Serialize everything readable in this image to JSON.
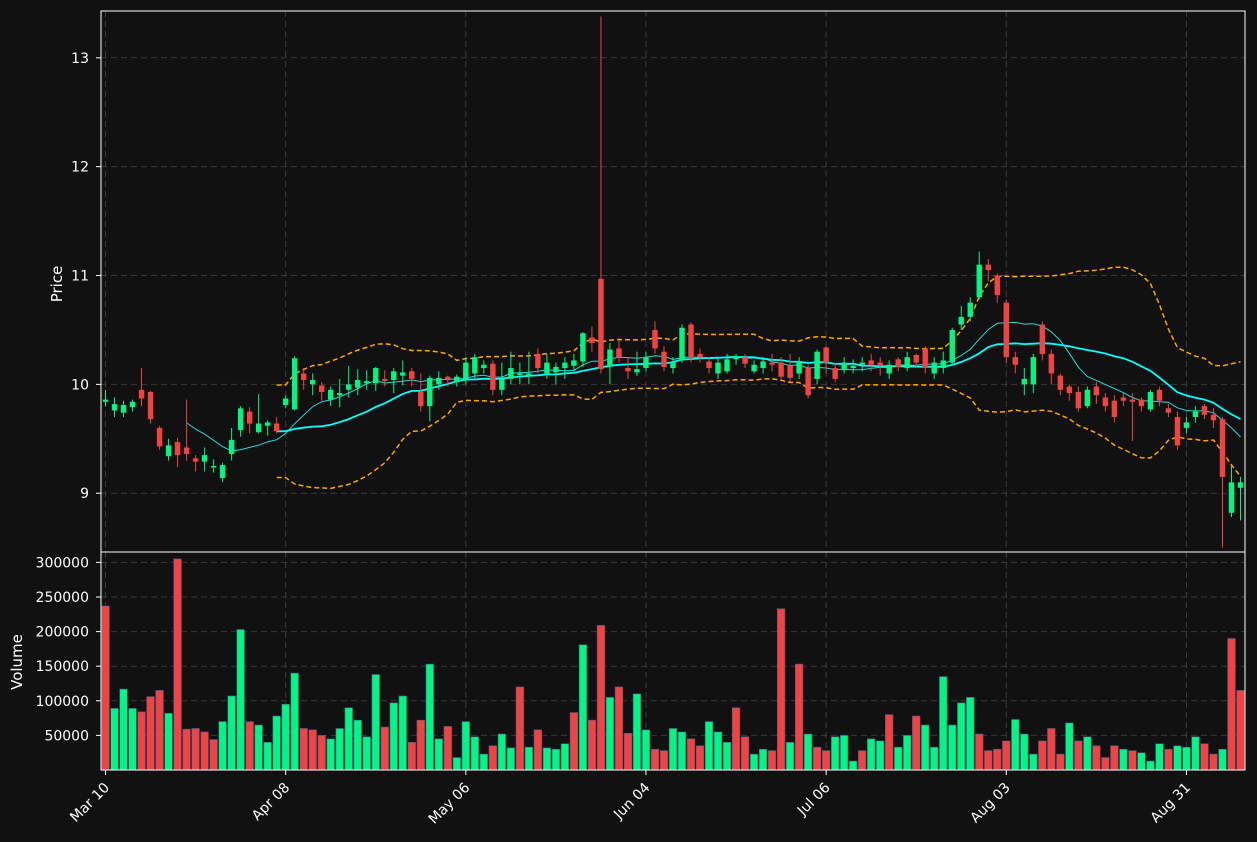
{
  "chart_data": {
    "type": "candlestick",
    "colors": {
      "background": "#111111",
      "up": "#00f583",
      "down": "#f24343",
      "grid": "#3a3a3a",
      "axis": "#ffffff",
      "ma_fast": "#26d9d9",
      "ma_slow": "#00ffff",
      "band": "#ffa500"
    },
    "price_panel": {
      "ylabel": "Price",
      "yticks": [
        9,
        10,
        11,
        12,
        13
      ],
      "ylim": [
        8.46,
        13.43
      ],
      "grid": true
    },
    "volume_panel": {
      "ylabel": "Volume",
      "yticks": [
        50000,
        100000,
        150000,
        200000,
        250000,
        300000
      ],
      "ylim": [
        0,
        315000
      ],
      "grid": true
    },
    "xaxis": {
      "tick_labels": [
        "Mar 10",
        "Apr 08",
        "May 06",
        "Jun 04",
        "Jul 06",
        "Aug 03",
        "Aug 31"
      ],
      "tick_indices": [
        0,
        20,
        40,
        60,
        80,
        100,
        120
      ],
      "n_bars": 127
    },
    "candles": [
      [
        9.84,
        9.86,
        9.95,
        9.8
      ],
      [
        9.76,
        9.82,
        9.88,
        9.7
      ],
      [
        9.74,
        9.81,
        9.85,
        9.7
      ],
      [
        9.79,
        9.84,
        9.86,
        9.75
      ],
      [
        9.95,
        9.87,
        10.15,
        9.8
      ],
      [
        9.93,
        9.68,
        9.94,
        9.64
      ],
      [
        9.6,
        9.43,
        9.62,
        9.4
      ],
      [
        9.34,
        9.44,
        9.5,
        9.3
      ],
      [
        9.47,
        9.35,
        9.51,
        9.24
      ],
      [
        9.42,
        9.36,
        9.86,
        9.3
      ],
      [
        9.32,
        9.29,
        9.35,
        9.2
      ],
      [
        9.29,
        9.35,
        9.42,
        9.2
      ],
      [
        9.25,
        9.25,
        9.31,
        9.19
      ],
      [
        9.14,
        9.26,
        9.28,
        9.1
      ],
      [
        9.36,
        9.49,
        9.6,
        9.3
      ],
      [
        9.58,
        9.78,
        9.8,
        9.52
      ],
      [
        9.75,
        9.64,
        9.79,
        9.55
      ],
      [
        9.56,
        9.64,
        9.91,
        9.55
      ],
      [
        9.62,
        9.65,
        9.67,
        9.53
      ],
      [
        9.64,
        9.57,
        9.7,
        9.55
      ],
      [
        9.81,
        9.87,
        9.9,
        9.78
      ],
      [
        9.77,
        10.24,
        10.26,
        9.76
      ],
      [
        10.1,
        10.04,
        10.15,
        9.95
      ],
      [
        10.0,
        10.04,
        10.1,
        9.9
      ],
      [
        9.99,
        9.93,
        10.02,
        9.85
      ],
      [
        9.86,
        9.95,
        9.98,
        9.8
      ],
      [
        9.9,
        9.92,
        10.05,
        9.79
      ],
      [
        9.95,
        10.0,
        10.17,
        9.88
      ],
      [
        9.97,
        10.04,
        10.14,
        9.9
      ],
      [
        10.01,
        10.03,
        10.13,
        9.95
      ],
      [
        10.01,
        10.15,
        10.16,
        9.94
      ],
      [
        10.05,
        10.03,
        10.13,
        9.98
      ],
      [
        10.04,
        10.12,
        10.15,
        9.92
      ],
      [
        10.08,
        10.11,
        10.22,
        9.99
      ],
      [
        10.12,
        10.05,
        10.15,
        9.98
      ],
      [
        9.93,
        9.8,
        10.1,
        9.75
      ],
      [
        9.8,
        10.06,
        10.08,
        9.66
      ],
      [
        10.0,
        10.06,
        10.12,
        9.95
      ],
      [
        10.07,
        10.05,
        10.08,
        9.98
      ],
      [
        10.02,
        10.07,
        10.09,
        9.98
      ],
      [
        10.05,
        10.2,
        10.25,
        10.0
      ],
      [
        10.1,
        10.25,
        10.28,
        10.05
      ],
      [
        10.15,
        10.18,
        10.22,
        10.1
      ],
      [
        10.19,
        9.95,
        10.22,
        9.9
      ],
      [
        9.95,
        10.05,
        10.2,
        9.9
      ],
      [
        10.05,
        10.15,
        10.3,
        10.0
      ],
      [
        10.1,
        10.1,
        10.2,
        10.0
      ],
      [
        10.09,
        10.1,
        10.3,
        10.0
      ],
      [
        10.28,
        10.15,
        10.33,
        10.1
      ],
      [
        10.1,
        10.2,
        10.28,
        10.05
      ],
      [
        10.11,
        10.16,
        10.2,
        10.0
      ],
      [
        10.15,
        10.2,
        10.25,
        10.05
      ],
      [
        10.17,
        10.22,
        10.28,
        10.1
      ],
      [
        10.21,
        10.47,
        10.48,
        10.16
      ],
      [
        10.43,
        10.38,
        10.53,
        10.3
      ],
      [
        10.97,
        10.14,
        13.38,
        10.1
      ],
      [
        10.17,
        10.32,
        10.38,
        10.0
      ],
      [
        10.33,
        10.25,
        10.4,
        10.2
      ],
      [
        10.15,
        10.12,
        10.25,
        10.05
      ],
      [
        10.11,
        10.14,
        10.3,
        10.08
      ],
      [
        10.15,
        10.25,
        10.3,
        10.12
      ],
      [
        10.5,
        10.33,
        10.58,
        10.28
      ],
      [
        10.3,
        10.16,
        10.35,
        10.12
      ],
      [
        10.15,
        10.2,
        10.25,
        10.1
      ],
      [
        10.22,
        10.52,
        10.55,
        10.2
      ],
      [
        10.55,
        10.24,
        10.57,
        10.2
      ],
      [
        10.28,
        10.25,
        10.33,
        10.2
      ],
      [
        10.21,
        10.15,
        10.25,
        10.1
      ],
      [
        10.1,
        10.2,
        10.25,
        10.05
      ],
      [
        10.12,
        10.23,
        10.28,
        10.1
      ],
      [
        10.23,
        10.26,
        10.28,
        10.18
      ],
      [
        10.25,
        10.19,
        10.28,
        10.15
      ],
      [
        10.12,
        10.18,
        10.22,
        10.1
      ],
      [
        10.15,
        10.21,
        10.23,
        10.1
      ],
      [
        10.2,
        10.18,
        10.28,
        10.12
      ],
      [
        10.2,
        10.07,
        10.25,
        10.05
      ],
      [
        10.17,
        10.06,
        10.28,
        10.03
      ],
      [
        10.1,
        10.21,
        10.25,
        10.05
      ],
      [
        10.15,
        9.9,
        10.18,
        9.87
      ],
      [
        10.05,
        10.3,
        10.32,
        10.0
      ],
      [
        10.34,
        10.2,
        10.35,
        10.1
      ],
      [
        10.15,
        10.05,
        10.2,
        10.02
      ],
      [
        10.13,
        10.2,
        10.25,
        10.1
      ],
      [
        10.15,
        10.17,
        10.23,
        10.1
      ],
      [
        10.18,
        10.2,
        10.25,
        10.12
      ],
      [
        10.22,
        10.18,
        10.28,
        10.12
      ],
      [
        10.2,
        10.17,
        10.25,
        10.08
      ],
      [
        10.1,
        10.18,
        10.22,
        10.05
      ],
      [
        10.23,
        10.16,
        10.25,
        10.12
      ],
      [
        10.15,
        10.25,
        10.3,
        10.12
      ],
      [
        10.27,
        10.2,
        10.28,
        10.15
      ],
      [
        10.33,
        10.15,
        10.35,
        10.1
      ],
      [
        10.1,
        10.2,
        10.25,
        10.05
      ],
      [
        10.15,
        10.22,
        10.3,
        10.1
      ],
      [
        10.2,
        10.5,
        10.52,
        10.18
      ],
      [
        10.55,
        10.62,
        10.72,
        10.5
      ],
      [
        10.62,
        10.75,
        10.8,
        10.58
      ],
      [
        10.8,
        11.1,
        11.22,
        10.78
      ],
      [
        11.1,
        11.05,
        11.15,
        10.95
      ],
      [
        11.0,
        10.82,
        11.02,
        10.75
      ],
      [
        10.75,
        10.25,
        10.78,
        10.2
      ],
      [
        10.25,
        10.18,
        10.3,
        10.1
      ],
      [
        10.0,
        10.05,
        10.15,
        9.9
      ],
      [
        10.0,
        10.25,
        10.28,
        9.92
      ],
      [
        10.55,
        10.28,
        10.58,
        10.22
      ],
      [
        10.28,
        10.1,
        10.32,
        10.0
      ],
      [
        10.08,
        9.95,
        10.1,
        9.9
      ],
      [
        9.98,
        9.92,
        10.0,
        9.85
      ],
      [
        9.93,
        9.78,
        9.98,
        9.75
      ],
      [
        9.8,
        9.95,
        9.98,
        9.78
      ],
      [
        9.98,
        9.9,
        10.02,
        9.82
      ],
      [
        9.88,
        9.8,
        9.92,
        9.75
      ],
      [
        9.85,
        9.7,
        9.9,
        9.65
      ],
      [
        9.88,
        9.85,
        9.92,
        9.8
      ],
      [
        9.86,
        9.84,
        9.92,
        9.48
      ],
      [
        9.86,
        9.8,
        9.88,
        9.75
      ],
      [
        9.77,
        9.93,
        9.95,
        9.75
      ],
      [
        9.95,
        9.85,
        9.98,
        9.8
      ],
      [
        9.78,
        9.74,
        9.82,
        9.7
      ],
      [
        9.7,
        9.44,
        9.75,
        9.4
      ],
      [
        9.6,
        9.65,
        9.7,
        9.55
      ],
      [
        9.7,
        9.75,
        9.8,
        9.65
      ],
      [
        9.8,
        9.72,
        9.82,
        9.68
      ],
      [
        9.72,
        9.67,
        9.78,
        9.6
      ],
      [
        9.68,
        9.15,
        9.7,
        8.5
      ],
      [
        8.82,
        9.1,
        9.25,
        8.78
      ],
      [
        9.05,
        9.1,
        9.15,
        8.75
      ]
    ],
    "volumes": [
      237000,
      89000,
      117000,
      89000,
      84000,
      106000,
      115000,
      82000,
      305000,
      59000,
      60000,
      55000,
      44000,
      70000,
      107000,
      203000,
      70000,
      65000,
      40000,
      78000,
      95000,
      140000,
      60000,
      58000,
      50000,
      45000,
      60000,
      90000,
      72000,
      48000,
      138000,
      62000,
      97000,
      107000,
      40000,
      72000,
      153000,
      45000,
      63000,
      18000,
      70000,
      48000,
      23000,
      35000,
      52000,
      32000,
      120000,
      33000,
      58000,
      32000,
      30000,
      38000,
      83000,
      181000,
      72000,
      209000,
      105000,
      120000,
      53000,
      110000,
      58000,
      30000,
      28000,
      60000,
      55000,
      45000,
      35000,
      70000,
      55000,
      40000,
      90000,
      48000,
      23000,
      30000,
      28000,
      233000,
      40000,
      153000,
      52000,
      33000,
      28000,
      48000,
      50000,
      13000,
      28000,
      45000,
      42000,
      80000,
      33000,
      50000,
      78000,
      65000,
      33000,
      135000,
      65000,
      97000,
      105000,
      52000,
      28000,
      30000,
      42000,
      73000,
      52000,
      23000,
      42000,
      60000,
      23000,
      68000,
      42000,
      48000,
      35000,
      18000,
      35000,
      30000,
      28000,
      25000,
      13000,
      38000,
      30000,
      35000,
      33000,
      48000,
      38000,
      23000,
      30000,
      190000,
      115000
    ],
    "volume_up": [
      false,
      true,
      true,
      true,
      false,
      false,
      false,
      true,
      false,
      false,
      false,
      false,
      false,
      true,
      true,
      true,
      false,
      true,
      true,
      true,
      true,
      true,
      false,
      false,
      false,
      true,
      true,
      true,
      true,
      true,
      true,
      false,
      true,
      true,
      false,
      false,
      true,
      true,
      false,
      true,
      true,
      true,
      true,
      false,
      true,
      true,
      false,
      true,
      false,
      true,
      true,
      true,
      false,
      true,
      false,
      false,
      true,
      false,
      false,
      true,
      true,
      false,
      false,
      true,
      true,
      false,
      false,
      true,
      true,
      true,
      false,
      false,
      true,
      true,
      false,
      false,
      true,
      false,
      true,
      false,
      false,
      true,
      true,
      true,
      false,
      true,
      true,
      false,
      true,
      true,
      false,
      true,
      true,
      true,
      true,
      true,
      true,
      false,
      false,
      false,
      false,
      true,
      true,
      true,
      false,
      false,
      false,
      true,
      false,
      true,
      false,
      false,
      false,
      true,
      false,
      true,
      true,
      true,
      false,
      true,
      true,
      true,
      false,
      false,
      true,
      false,
      false
    ]
  }
}
